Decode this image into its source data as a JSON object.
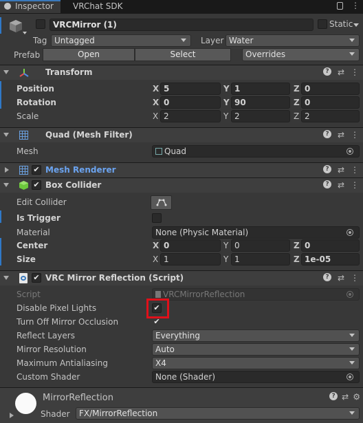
{
  "tabs": {
    "inspector": "Inspector",
    "vrchat_sdk": "VRChat SDK"
  },
  "object": {
    "name": "VRCMirror (1)",
    "static_label": "Static",
    "tag_label": "Tag",
    "tag_value": "Untagged",
    "layer_label": "Layer",
    "layer_value": "Water",
    "prefab_label": "Prefab",
    "open_label": "Open",
    "select_label": "Select",
    "overrides_label": "Overrides"
  },
  "transform": {
    "title": "Transform",
    "position_label": "Position",
    "rotation_label": "Rotation",
    "scale_label": "Scale",
    "position": {
      "x": "5",
      "y": "1",
      "z": "0"
    },
    "rotation": {
      "x": "0",
      "y": "90",
      "z": "0"
    },
    "scale": {
      "x": "2",
      "y": "2",
      "z": "2"
    }
  },
  "axis": {
    "x": "X",
    "y": "Y",
    "z": "Z"
  },
  "mesh_filter": {
    "title": "Quad (Mesh Filter)",
    "mesh_label": "Mesh",
    "mesh_value": "Quad"
  },
  "mesh_renderer": {
    "title": "Mesh Renderer",
    "enabled": true
  },
  "box_collider": {
    "title": "Box Collider",
    "edit_label": "Edit Collider",
    "is_trigger_label": "Is Trigger",
    "material_label": "Material",
    "material_value": "None (Physic Material)",
    "center_label": "Center",
    "size_label": "Size",
    "center": {
      "x": "0",
      "y": "0",
      "z": "0"
    },
    "size": {
      "x": "1",
      "y": "1",
      "z": "1e-05"
    }
  },
  "mirror": {
    "title": "VRC Mirror Reflection (Script)",
    "script_label": "Script",
    "script_value": "VRCMirrorReflection",
    "disable_pixel_lights_label": "Disable Pixel Lights",
    "disable_pixel_lights": true,
    "turn_off_occlusion_label": "Turn Off Mirror Occlusion",
    "turn_off_occlusion": true,
    "reflect_layers_label": "Reflect Layers",
    "reflect_layers_value": "Everything",
    "mirror_resolution_label": "Mirror Resolution",
    "mirror_resolution_value": "Auto",
    "max_aa_label": "Maximum Antialiasing",
    "max_aa_value": "X4",
    "custom_shader_label": "Custom Shader",
    "custom_shader_value": "None (Shader)"
  },
  "material": {
    "name": "MirrorReflection",
    "shader_label": "Shader",
    "shader_value": "FX/MirrorReflection"
  },
  "checkmark": "✔",
  "colors": {
    "accent_blue": "#2f79c8",
    "highlight_red": "#e0101a",
    "component_name_blue": "#6ba3ef"
  }
}
